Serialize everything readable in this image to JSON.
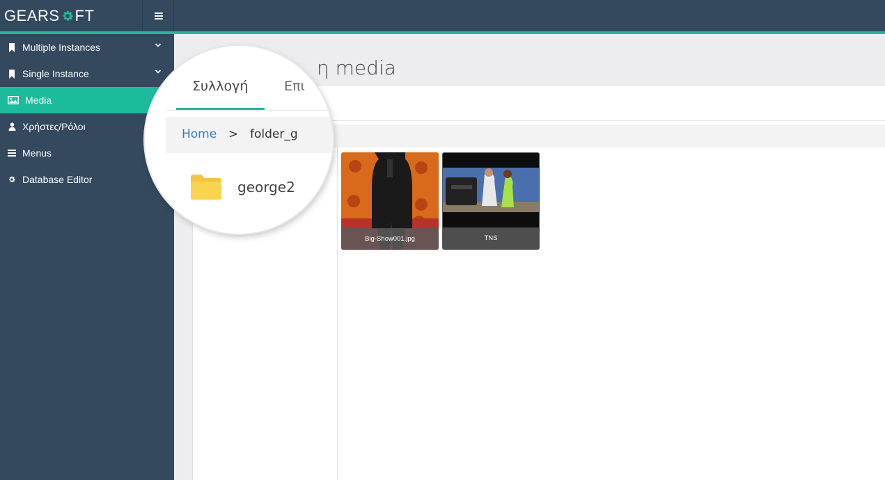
{
  "app": {
    "logo_left": "GEARS",
    "logo_right": "FT",
    "accent": "#1abc9c",
    "nav_bg": "#34495e"
  },
  "sidebar": {
    "items": [
      {
        "label": "Multiple Instances",
        "icon": "bookmark-icon",
        "has_chevron": true
      },
      {
        "label": "Single Instance",
        "icon": "bookmark-icon",
        "has_chevron": true
      },
      {
        "label": "Media",
        "icon": "image-icon",
        "active": true
      },
      {
        "label": "Χρήστες/Ρόλοι",
        "icon": "user-icon"
      },
      {
        "label": "Menus",
        "icon": "list-icon"
      },
      {
        "label": "Database Editor",
        "icon": "gear-icon"
      }
    ]
  },
  "page": {
    "title_visible": "η media"
  },
  "magnifier": {
    "tabs": [
      "Συλλογή",
      "Επι"
    ],
    "breadcrumb": {
      "home": "Home",
      "separator": ">",
      "current": "folder_g"
    },
    "folder": {
      "name": "george2",
      "icon": "folder-icon",
      "color": "#f5c342"
    }
  },
  "media": [
    {
      "caption": "Big-Show001.jpg"
    },
    {
      "caption": "TNS"
    }
  ]
}
